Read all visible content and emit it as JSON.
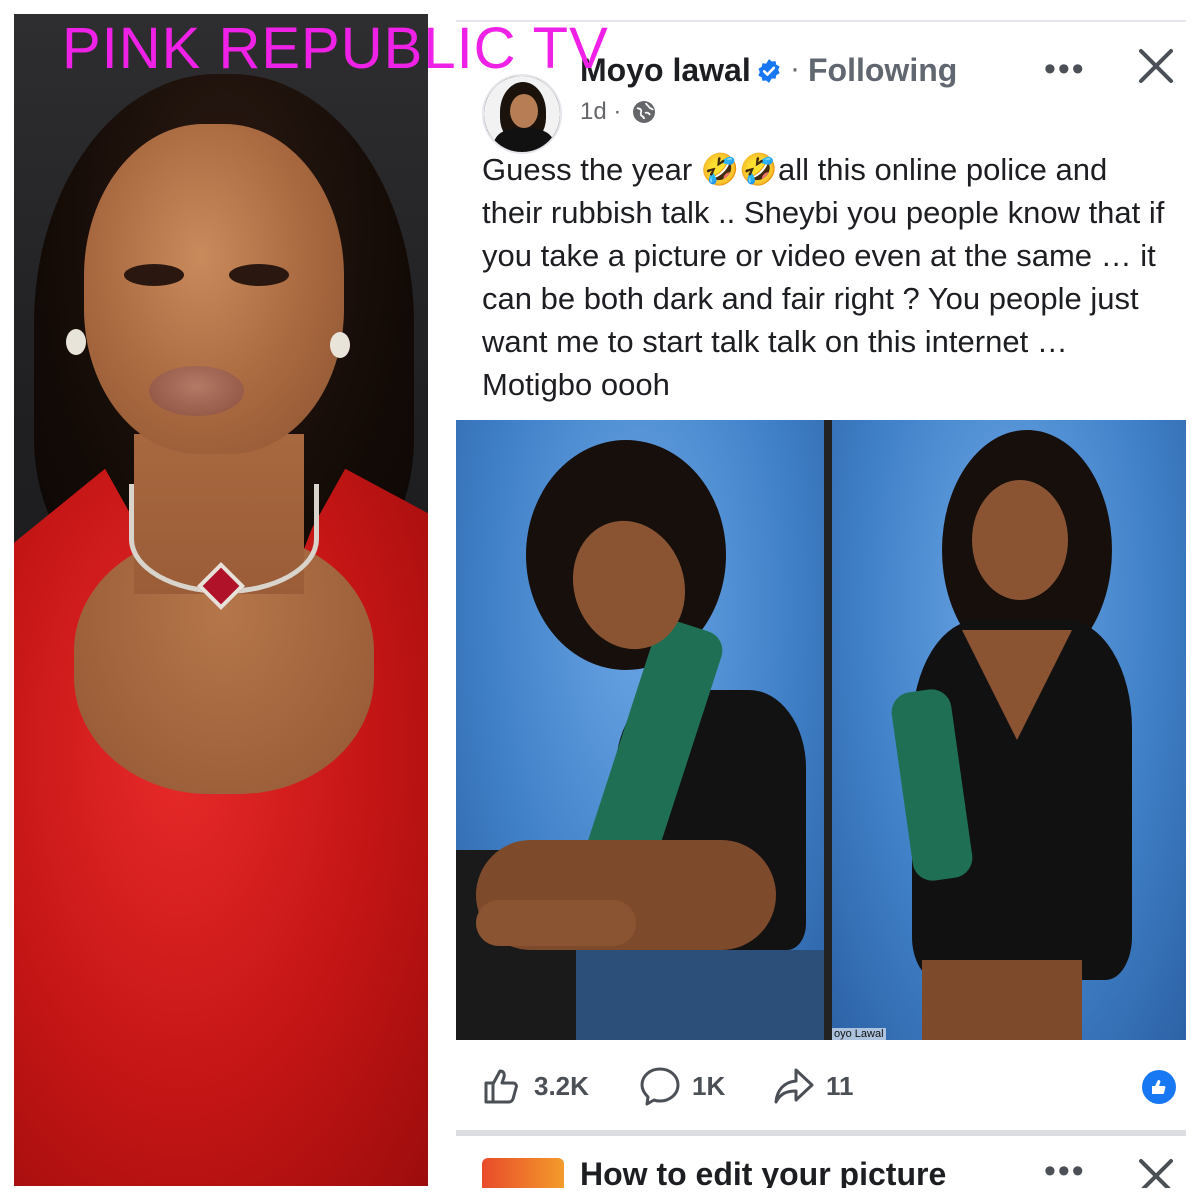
{
  "watermark": "PINK REPUBLIC TV",
  "post": {
    "author": "Moyo lawal",
    "follow_status": "Following",
    "separator": "·",
    "time": "1d ·",
    "text": "Guess the year 🤣🤣all this online police and their rubbish talk .. Sheybi you people know that if you take a picture or video even at the same … it can be both dark and fair right ?  You people just want me to start talk talk on this internet … Motigbo oooh",
    "more_label": "•••",
    "photo_caption": "oyo Lawal",
    "counts": {
      "likes": "3.2K",
      "comments": "1K",
      "shares": "11"
    }
  },
  "next_post": {
    "title": "How to edit your picture",
    "more_label": "•••"
  },
  "icons": {
    "verified": "verified-badge-icon",
    "globe": "globe-icon",
    "close": "close-icon",
    "like": "thumbs-up-icon",
    "comment": "comment-bubble-icon",
    "share": "share-arrow-icon",
    "reaction": "like-reaction-icon"
  },
  "colors": {
    "watermark": "#f021e6",
    "brand_blue": "#1877f2",
    "text": "#1c1e21",
    "secondary": "#65676b"
  }
}
